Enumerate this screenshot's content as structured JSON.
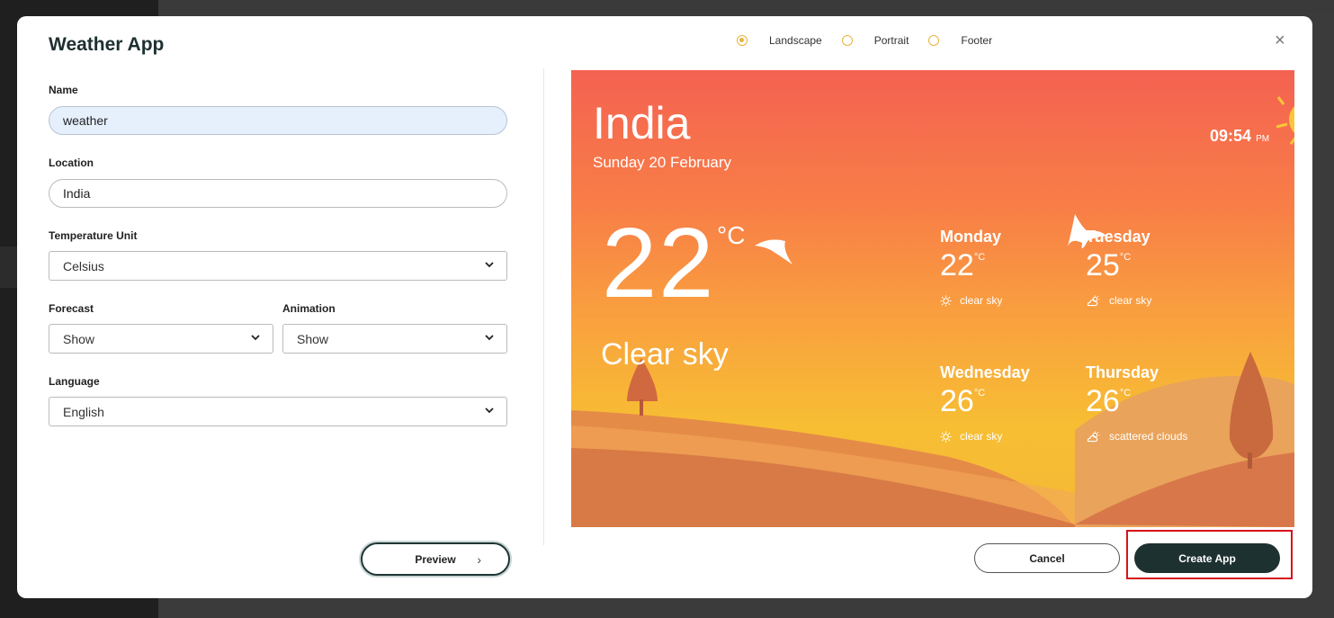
{
  "modal": {
    "title": "Weather App",
    "close_icon": "×",
    "orientation_options": [
      {
        "label": "Landscape",
        "selected": true
      },
      {
        "label": "Portrait",
        "selected": false
      },
      {
        "label": "Footer",
        "selected": false
      }
    ]
  },
  "form": {
    "name_label": "Name",
    "name_value": "weather",
    "location_label": "Location",
    "location_value": "India",
    "temp_unit_label": "Temperature Unit",
    "temp_unit_value": "Celsius",
    "forecast_label": "Forecast",
    "forecast_value": "Show",
    "animation_label": "Animation",
    "animation_value": "Show",
    "language_label": "Language",
    "language_value": "English"
  },
  "buttons": {
    "preview": "Preview",
    "cancel": "Cancel",
    "create": "Create App"
  },
  "weather_preview": {
    "city": "India",
    "date": "Sunday 20 February",
    "time": "09:54",
    "time_suffix": "PM",
    "temperature": "22",
    "unit": "°C",
    "condition": "Clear sky",
    "forecast": [
      {
        "day": "Monday",
        "temp": "22",
        "unit": "°C",
        "condition": "clear sky",
        "icon": "sun-icon"
      },
      {
        "day": "Tuesday",
        "temp": "25",
        "unit": "°C",
        "condition": "clear sky",
        "icon": "cloud-sun-icon"
      },
      {
        "day": "Wednesday",
        "temp": "26",
        "unit": "°C",
        "condition": "clear sky",
        "icon": "sun-icon"
      },
      {
        "day": "Thursday",
        "temp": "26",
        "unit": "°C",
        "condition": "scattered clouds",
        "icon": "cloud-sun-icon"
      }
    ]
  },
  "colors": {
    "accent": "#e8b43a",
    "primary_button": "#1e3131",
    "highlight_border": "#d6111a"
  }
}
